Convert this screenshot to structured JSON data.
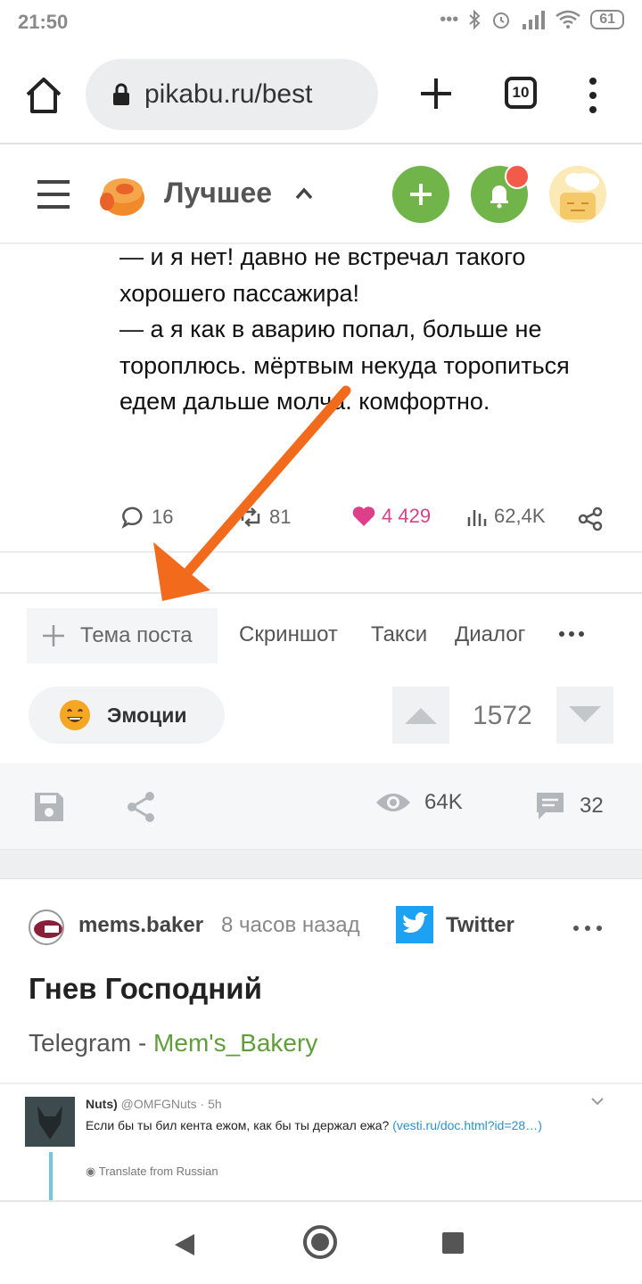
{
  "status_bar": {
    "time": "21:50",
    "battery": "61",
    "icons": [
      "more-icon",
      "bluetooth-icon",
      "alarm-icon",
      "signal-icon",
      "wifi-icon",
      "battery-icon"
    ]
  },
  "browser": {
    "url": "pikabu.ru/best",
    "tab_count": "10"
  },
  "site_header": {
    "section_title": "Лучшее",
    "accent_color": "#71b54a",
    "notification_dot_color": "#f25a4a"
  },
  "post": {
    "lines": [
      "— и я нет! давно не встречал такого хорошего пассажира!",
      "— а я как в аварию попал, больше не тороплюсь. мёртвым некуда торопиться",
      "",
      "едем дальше молча. комфортно."
    ],
    "stats": {
      "comments": "16",
      "reposts": "81",
      "likes": "4 429",
      "views": "62,4K"
    },
    "tags": {
      "add_label": "Тема поста",
      "items": [
        "Скриншот",
        "Такси",
        "Диалог"
      ]
    },
    "emotions_label": "Эмоции",
    "rating": "1572",
    "actions": {
      "views": "64K",
      "comments": "32"
    }
  },
  "next_post": {
    "author": "mems.baker",
    "time": "8 часов назад",
    "community": "Twitter",
    "title": "Гнев Господний",
    "source_prefix": "Telegram - ",
    "source_link": "Mem's_Bakery",
    "tweet": {
      "name": "Nuts)",
      "handle": "@OMFGNuts · 5h",
      "text": "Если бы ты бил кента ежом, как бы ты держал ежа? ",
      "link": "(vesti.ru/doc.html?id=28…)",
      "translate": "Translate from Russian"
    }
  },
  "annotation": {
    "arrow_color": "#f26a1b"
  }
}
